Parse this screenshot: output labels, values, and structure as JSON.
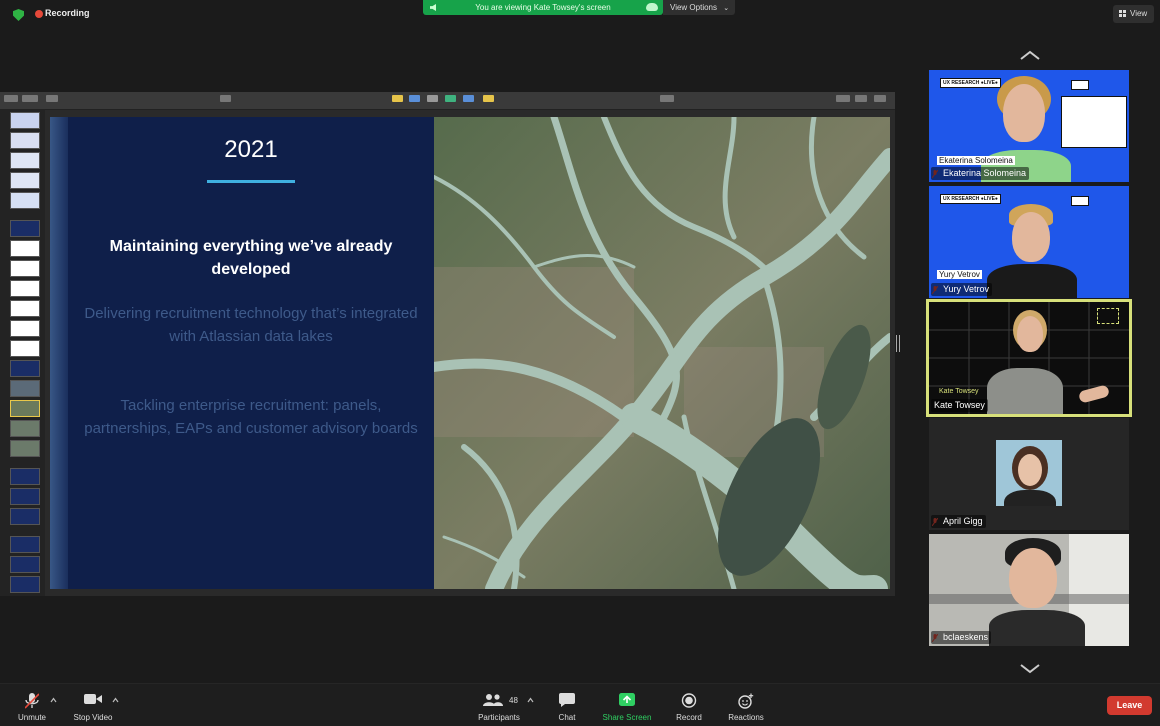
{
  "top": {
    "recording_label": "Recording",
    "viewing_banner": "You are viewing Kate Towsey's screen",
    "view_options_label": "View Options",
    "view_label": "View"
  },
  "slide": {
    "year": "2021",
    "headline": "Maintaining everything we’ve already developed",
    "paragraph_1": "Delivering recruitment technology that’s integrated with Atlassian data lakes",
    "paragraph_2": "Tackling enterprise recruitment: panels, partnerships, EAPs and customer advisory boards"
  },
  "participants": [
    {
      "name": "Ekaterina Solomeina",
      "tile_label": "Ekaterina Solomeina",
      "tag": "UX RESEARCH ●LIVE●"
    },
    {
      "name": "Yury Vetrov",
      "tile_label": "Yury Vetrov",
      "tag": "UX RESEARCH ●LIVE●"
    },
    {
      "name": "Kate Towsey",
      "tile_label": "Kate Towsey"
    },
    {
      "name": "April Gigg"
    },
    {
      "name": "bclaeskens"
    }
  ],
  "toolbar": {
    "unmute_label": "Unmute",
    "stop_video_label": "Stop Video",
    "participants_label": "Participants",
    "participants_count": "48",
    "chat_label": "Chat",
    "share_screen_label": "Share Screen",
    "record_label": "Record",
    "reactions_label": "Reactions",
    "leave_label": "Leave"
  },
  "colors": {
    "share_green": "#17a34a",
    "leave_red": "#d23a2f",
    "active_speaker_outline": "#d7e07a",
    "slide_navy": "#0f1f4a",
    "tile_blue": "#1f57ea"
  },
  "icons": [
    "shield-icon",
    "recording-dot-icon",
    "speaker-icon",
    "cloud-icon",
    "chevron-down-icon",
    "grid-icon",
    "chevron-up-icon",
    "mic-off-icon",
    "camera-icon",
    "participants-icon",
    "chat-icon",
    "share-screen-icon",
    "record-icon",
    "reactions-icon"
  ]
}
